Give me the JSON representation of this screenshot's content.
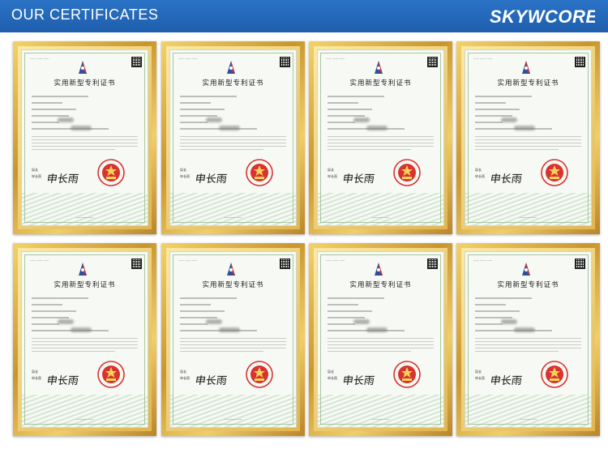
{
  "header": {
    "title": "OUR CERTIFICATES",
    "logo_text": "SKYWCORE",
    "background_color": "#2568b8",
    "text_color": "#ffffff"
  },
  "certificate": {
    "title": "实用新型专利证书",
    "signature": "申长雨",
    "frame_color": "#d4a63d",
    "seal_color": "#d8332f",
    "icons": [
      "patent-emblem-icon",
      "qr-code-icon",
      "national-seal-icon"
    ]
  },
  "certificates": [
    {
      "title": "实用新型专利证书",
      "signature": "申长雨"
    },
    {
      "title": "实用新型专利证书",
      "signature": "申长雨"
    },
    {
      "title": "实用新型专利证书",
      "signature": "申长雨"
    },
    {
      "title": "实用新型专利证书",
      "signature": "申长雨"
    },
    {
      "title": "实用新型专利证书",
      "signature": "申长雨"
    },
    {
      "title": "实用新型专利证书",
      "signature": "申长雨"
    },
    {
      "title": "实用新型专利证书",
      "signature": "申长雨"
    },
    {
      "title": "实用新型专利证书",
      "signature": "申长雨"
    }
  ]
}
